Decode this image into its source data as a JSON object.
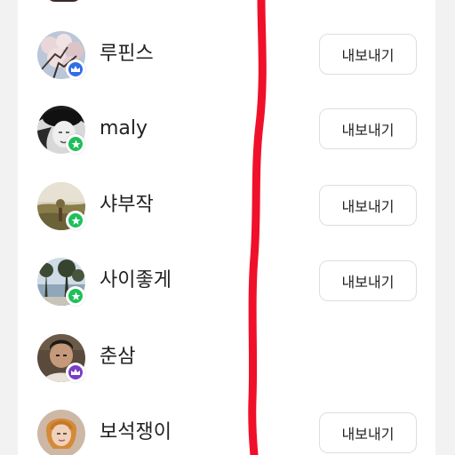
{
  "followers": [
    {
      "name": "루핀스",
      "badge_icon": "crown-icon",
      "badge_color": "#2f6ee8",
      "export_label": "내보내기",
      "avatar_kind": "blossom"
    },
    {
      "name": "maly",
      "badge_icon": "star-icon",
      "badge_color": "#1fbf5a",
      "export_label": "내보내기",
      "avatar_kind": "portrait-bw"
    },
    {
      "name": "샤부작",
      "badge_icon": "star-icon",
      "badge_color": "#1fbf5a",
      "export_label": "내보내기",
      "avatar_kind": "landscape-sunset"
    },
    {
      "name": "사이좋게",
      "badge_icon": "star-icon",
      "badge_color": "#1fbf5a",
      "export_label": "내보내기",
      "avatar_kind": "trees-water"
    },
    {
      "name": "춘삼",
      "badge_icon": "crown-icon",
      "badge_color": "#7a3cc8",
      "export_label": "",
      "avatar_kind": "man-portrait"
    },
    {
      "name": "보석쟁이",
      "badge_icon": "",
      "badge_color": "",
      "export_label": "내보내기",
      "avatar_kind": "woman-portrait"
    }
  ],
  "colors": {
    "annotation_stroke": "#f0102a",
    "background": "#f2f2f2",
    "card": "#ffffff"
  }
}
